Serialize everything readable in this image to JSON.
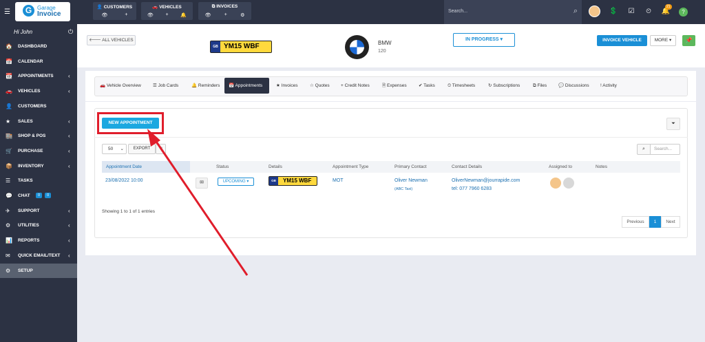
{
  "topbar": {
    "logo_line1": "Garage",
    "logo_line2": "Invoice",
    "quick_groups": [
      {
        "title": "CUSTOMERS"
      },
      {
        "title": "VEHICLES"
      },
      {
        "title": "INVOICES"
      }
    ],
    "search_placeholder": "Search...",
    "notification_count": "21"
  },
  "sidebar": {
    "greeting": "Hi John",
    "items": [
      {
        "label": "DASHBOARD",
        "arrow": false
      },
      {
        "label": "CALENDAR",
        "arrow": false
      },
      {
        "label": "APPOINTMENTS",
        "arrow": true
      },
      {
        "label": "VEHICLES",
        "arrow": true
      },
      {
        "label": "CUSTOMERS",
        "arrow": false
      },
      {
        "label": "SALES",
        "arrow": true
      },
      {
        "label": "SHOP & POS",
        "arrow": true
      },
      {
        "label": "PURCHASE",
        "arrow": true
      },
      {
        "label": "INVENTORY",
        "arrow": true
      },
      {
        "label": "TASKS",
        "arrow": false
      },
      {
        "label": "CHAT",
        "arrow": false,
        "badges": [
          "0",
          "0"
        ]
      },
      {
        "label": "SUPPORT",
        "arrow": true
      },
      {
        "label": "UTILITIES",
        "arrow": true
      },
      {
        "label": "REPORTS",
        "arrow": true
      },
      {
        "label": "QUICK EMAIL/TEXT",
        "arrow": true
      },
      {
        "label": "SETUP",
        "arrow": false,
        "active": true
      }
    ]
  },
  "header": {
    "back_label": "ALL VEHICLES",
    "plate_country": "GB",
    "plate": "YM15 WBF",
    "make": "BMW",
    "model": "120",
    "status_label": "IN PROGRESS",
    "invoice_vehicle_label": "INVOICE VEHICLE",
    "more_label": "MORE"
  },
  "tabs": [
    {
      "label": "Vehicle Overview"
    },
    {
      "label": "Job Cards"
    },
    {
      "label": "Reminders"
    },
    {
      "label": "Appointments",
      "active": true
    },
    {
      "label": "Invoices"
    },
    {
      "label": "Quotes"
    },
    {
      "label": "Credit Notes"
    },
    {
      "label": "Expenses"
    },
    {
      "label": "Tasks"
    },
    {
      "label": "Timesheets"
    },
    {
      "label": "Subscriptions"
    },
    {
      "label": "Files"
    },
    {
      "label": "Discussions"
    },
    {
      "label": "Activity"
    }
  ],
  "appointments": {
    "new_button": "NEW APPOINTMENT",
    "page_length": "50",
    "export_label": "EXPORT",
    "search_placeholder": "Search...",
    "columns": [
      "Appointment Date",
      "",
      "Status",
      "Details",
      "Appointment Type",
      "Primary Contact",
      "Contact Details",
      "Assigned to",
      "Notes"
    ],
    "rows": [
      {
        "date": "23/08/2022 10:00",
        "status": "UPCOMING",
        "plate_country": "GB",
        "plate": "YM15 WBF",
        "type": "MOT",
        "contact_name": "Oliver Newman",
        "contact_company": "(ABC Taxi)",
        "email": "OliverNewman@jourrapide.com",
        "phone": "tel: 077 7960 6283"
      }
    ],
    "entries_info": "Showing 1 to 1 of 1 entries",
    "pagination": {
      "previous": "Previous",
      "current": "1",
      "next": "Next"
    }
  },
  "colors": {
    "sidebar_bg": "#2c3243",
    "primary": "#1a8fd6",
    "highlight": "#e01d2b",
    "plate_yellow": "#ffd93d"
  }
}
